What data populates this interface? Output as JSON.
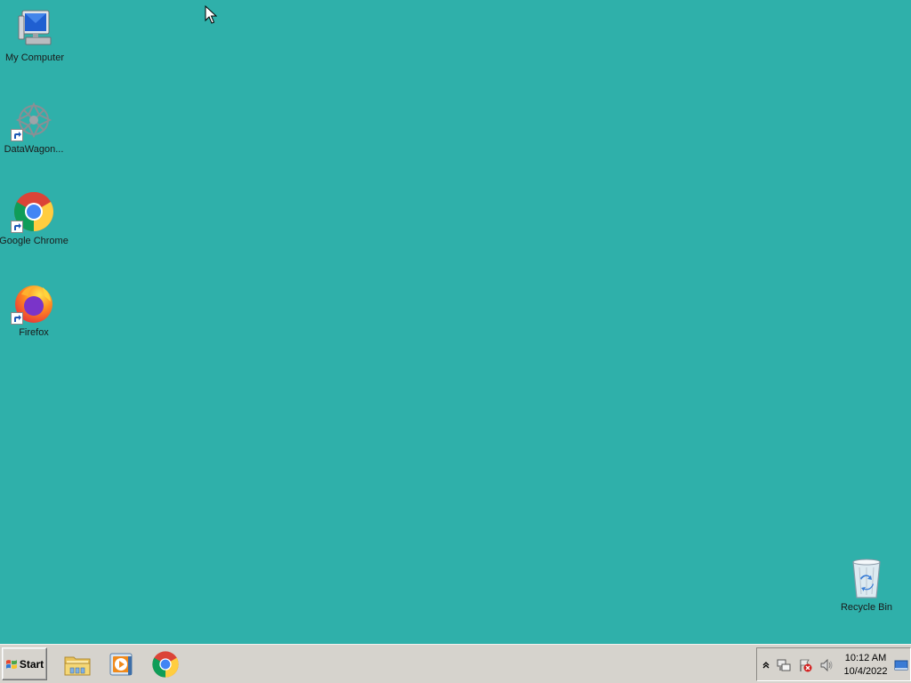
{
  "desktop": {
    "background_color": "#2fb0aa",
    "icons": [
      {
        "label": "My Computer",
        "icon": "computer-icon",
        "shortcut": false
      },
      {
        "label": "DataWagon...",
        "icon": "datawagon-icon",
        "shortcut": true
      },
      {
        "label": "Google Chrome",
        "icon": "chrome-icon",
        "shortcut": true
      },
      {
        "label": "Firefox",
        "icon": "firefox-icon",
        "shortcut": true
      },
      {
        "label": "Recycle Bin",
        "icon": "recycle-bin-icon",
        "shortcut": false
      }
    ]
  },
  "taskbar": {
    "start_label": "Start",
    "pinned_apps": [
      {
        "name": "File Explorer",
        "icon": "folder-icon"
      },
      {
        "name": "Media Player",
        "icon": "media-player-icon"
      },
      {
        "name": "Google Chrome",
        "icon": "chrome-icon"
      }
    ],
    "tray": {
      "icons": [
        "show-hidden-icons-chevron",
        "network-icon",
        "action-center-icon",
        "volume-icon"
      ],
      "time": "10:12 AM",
      "date": "10/4/2022"
    }
  }
}
